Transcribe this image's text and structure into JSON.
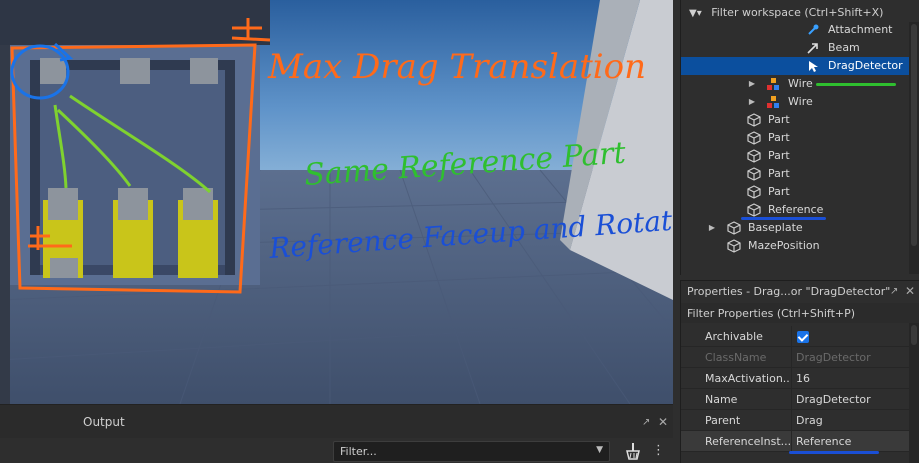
{
  "annotations": {
    "max_drag": "Max Drag Translation",
    "same_ref": "Same Reference Part",
    "ref_face": "Reference Faceup and Rotated"
  },
  "explorer": {
    "filter_placeholder": "Filter workspace (Ctrl+Shift+X)",
    "items": [
      {
        "label": "Attachment",
        "icon": "attachment-icon"
      },
      {
        "label": "Beam",
        "icon": "beam-icon"
      },
      {
        "label": "DragDetector",
        "icon": "drag-detector-icon",
        "selected": true
      },
      {
        "label": "Wire",
        "icon": "wire-icon",
        "expandable": true
      },
      {
        "label": "Wire",
        "icon": "wire-icon",
        "expandable": true
      },
      {
        "label": "Part",
        "icon": "part-icon"
      },
      {
        "label": "Part",
        "icon": "part-icon"
      },
      {
        "label": "Part",
        "icon": "part-icon"
      },
      {
        "label": "Part",
        "icon": "part-icon"
      },
      {
        "label": "Part",
        "icon": "part-icon"
      },
      {
        "label": "Reference",
        "icon": "part-icon"
      },
      {
        "label": "Baseplate",
        "icon": "part-icon",
        "expandable": true
      },
      {
        "label": "MazePosition",
        "icon": "part-icon"
      }
    ]
  },
  "properties": {
    "title": "Properties - Drag...or \"DragDetector\"",
    "filter_placeholder": "Filter Properties (Ctrl+Shift+P)",
    "rows": [
      {
        "name": "Archivable",
        "value": "",
        "checkbox": true
      },
      {
        "name": "ClassName",
        "value": "DragDetector",
        "disabled": true
      },
      {
        "name": "MaxActivation...",
        "value": "16"
      },
      {
        "name": "Name",
        "value": "DragDetector"
      },
      {
        "name": "Parent",
        "value": "Drag"
      },
      {
        "name": "ReferenceInst...",
        "value": "Reference",
        "highlight": true
      }
    ]
  },
  "output": {
    "title": "Output",
    "filter_placeholder": "Filter..."
  },
  "colors": {
    "orange": "#ff6a1a",
    "green": "#2fbf2f",
    "blue": "#1a4fd6",
    "selection": "#0b4f9e",
    "yellow_part": "#c9c51a"
  }
}
